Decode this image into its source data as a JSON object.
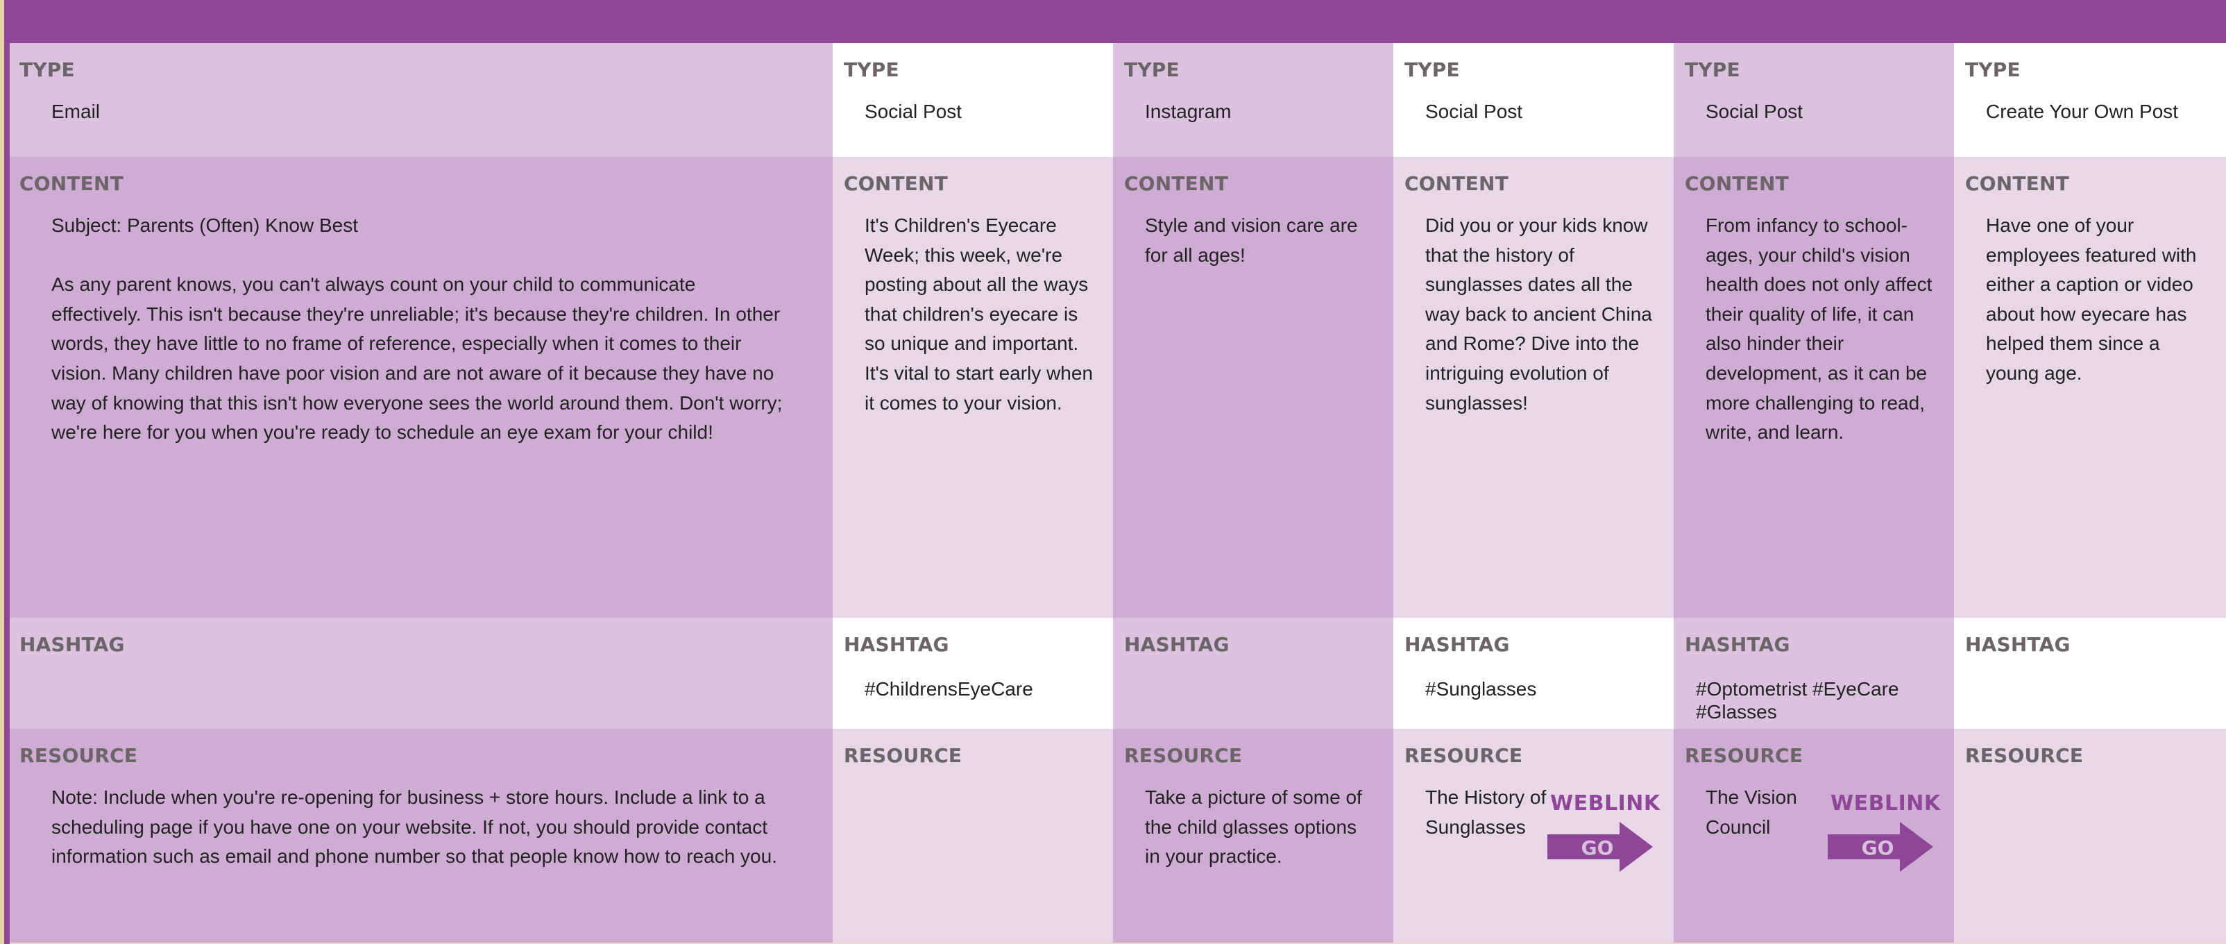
{
  "labels": {
    "type": "TYPE",
    "content": "CONTENT",
    "hashtag": "HASHTAG",
    "resource": "RESOURCE"
  },
  "columns": [
    {
      "type": "Email",
      "content": "Subject: Parents (Often) Know Best\n\nAs any parent knows, you can't always count on your child to communicate effectively. This isn't because they're unreliable; it's because they're children. In other words, they have little to no frame of reference, especially when it comes to their vision. Many children have poor vision and are not aware of it because they have no way of knowing that this isn't how everyone sees the world around them. Don't worry; we're here for you when you're ready to schedule an eye exam for your child!",
      "hashtag": "",
      "resource": "Note: Include when you're re-opening for business + store hours. Include a link to a scheduling page if you have one on your website. If not, you should provide contact information such as email and phone number so that people know how to reach you."
    },
    {
      "type": "Social Post",
      "content": "It's Children's Eyecare Week; this week, we're posting about all the ways that children's eyecare is so unique and important. It's vital to start early when it comes to your vision.",
      "hashtag": "#ChildrensEyeCare",
      "resource": ""
    },
    {
      "type": "Instagram",
      "content": "Style and vision care are for all ages!",
      "hashtag": "",
      "resource": "Take a picture of some of the child glasses options in your practice."
    },
    {
      "type": "Social Post",
      "content": "Did you or your kids know that the history of sunglasses dates all the way back to ancient China and Rome? Dive into the intriguing evolution of sunglasses!",
      "hashtag": "#Sunglasses",
      "resource": "The History of Sunglasses",
      "weblink": {
        "label": "WEBLINK",
        "button": "GO"
      }
    },
    {
      "type": "Social Post",
      "content": "From infancy to school-ages, your child's vision health does not only affect their quality of life, it can also hinder their development, as it can be more challenging to read, write, and learn.",
      "hashtag": "#Optometrist #EyeCare #Glasses",
      "resource": "The Vision Council",
      "weblink": {
        "label": "WEBLINK",
        "button": "GO"
      }
    },
    {
      "type": "Create Your Own Post",
      "content": "Have one of your employees featured with either a caption or video about how eyecare has helped them since a young age.",
      "hashtag": "",
      "resource": ""
    }
  ],
  "colors": {
    "accent": "#8e4797",
    "light": "#e7d7e9",
    "mid": "#dbc2df",
    "dark": "#cfacd4",
    "white": "#ffffff"
  }
}
